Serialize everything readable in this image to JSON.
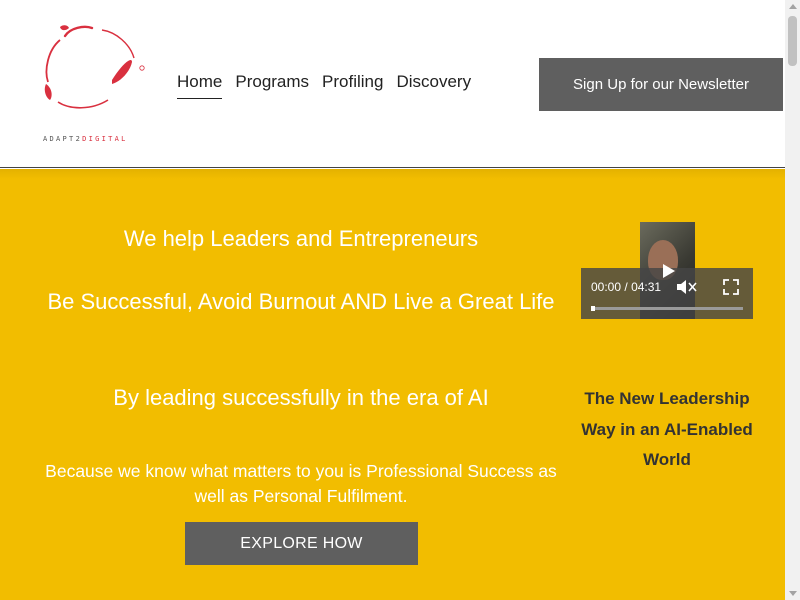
{
  "brand": {
    "logo_text_part1": "ADAPT2",
    "logo_text_part2": "DIGITAL",
    "registered_mark": "®",
    "accent_color": "#d9303f"
  },
  "nav": {
    "items": [
      {
        "label": "Home",
        "active": true
      },
      {
        "label": "Programs",
        "active": false
      },
      {
        "label": "Profiling",
        "active": false
      },
      {
        "label": "Discovery",
        "active": false
      }
    ]
  },
  "header": {
    "newsletter_label": "Sign Up for our Newsletter"
  },
  "hero": {
    "background_color": "#f2bd00",
    "headline_1": "We help Leaders and Entrepreneurs",
    "headline_2": "Be Successful, Avoid Burnout AND Live a Great Life",
    "headline_3": "By leading successfully in the era of AI",
    "subtext": "Because we know what matters to you is Professional Success as well as Personal Fulfilment.",
    "cta_label": "EXPLORE HOW"
  },
  "video": {
    "current_time": "00:00",
    "separator": "/",
    "duration": "04:31",
    "progress": 0
  },
  "side": {
    "caption": "The New Leadership Way in an AI-Enabled World"
  },
  "icons": [
    "play-icon",
    "volume-icon",
    "fullscreen-icon",
    "scroll-up-icon",
    "scroll-down-icon"
  ]
}
